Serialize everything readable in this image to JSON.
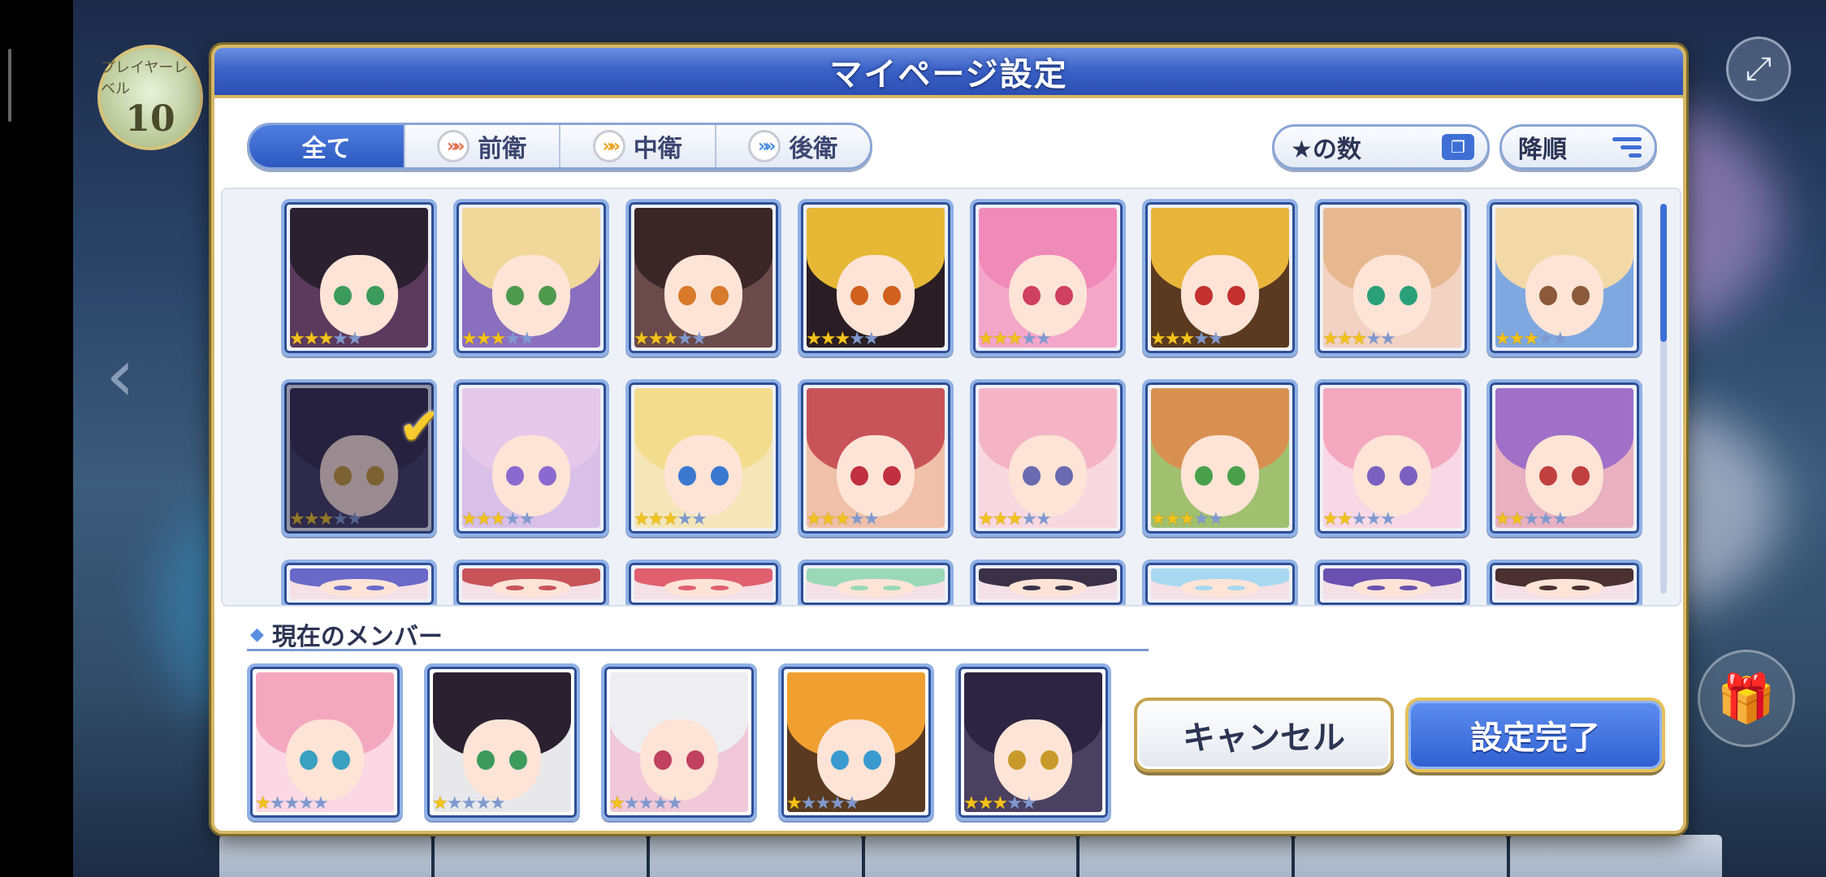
{
  "hud": {
    "level_label": "プレイヤーレベル",
    "level_value": "10"
  },
  "modal": {
    "title": "マイページ設定",
    "filters": [
      {
        "label": "全て",
        "active": true
      },
      {
        "label": "前衛",
        "icon": "red-chevron-icon"
      },
      {
        "label": "中衛",
        "icon": "orange-chevron-icon"
      },
      {
        "label": "後衛",
        "icon": "blue-chevron-icon"
      }
    ],
    "sort_key_label": "★の数",
    "sort_order_label": "降順",
    "characters": [
      {
        "stars": 3,
        "max": 5,
        "hair": "#2a2030",
        "eye": "#3c9a5c",
        "bg": "#5b3a5e"
      },
      {
        "stars": 3,
        "max": 5,
        "hair": "#f1d79a",
        "eye": "#4e9a4e",
        "bg": "#8a6fbf"
      },
      {
        "stars": 3,
        "max": 5,
        "hair": "#3a2626",
        "eye": "#d87a2a",
        "bg": "#6a4a4a"
      },
      {
        "stars": 3,
        "max": 5,
        "hair": "#e7b836",
        "eye": "#d06020",
        "bg": "#2a1e24"
      },
      {
        "stars": 3,
        "max": 5,
        "hair": "#f08ab8",
        "eye": "#d04060",
        "bg": "#f4a6c8"
      },
      {
        "stars": 3,
        "max": 5,
        "hair": "#e9b43a",
        "eye": "#c43030",
        "bg": "#5a3a20"
      },
      {
        "stars": 3,
        "max": 5,
        "hair": "#e7b890",
        "eye": "#2aa07a",
        "bg": "#f2d2c2"
      },
      {
        "stars": 3,
        "max": 5,
        "hair": "#f4d9a8",
        "eye": "#8a5a3a",
        "bg": "#7fa8e0"
      },
      {
        "stars": 3,
        "max": 5,
        "hair": "#2c2440",
        "eye": "#c89a2a",
        "bg": "#3a3458",
        "selected": true
      },
      {
        "stars": 3,
        "max": 5,
        "hair": "#e6c8ea",
        "eye": "#8a6ad0",
        "bg": "#d8c0e8"
      },
      {
        "stars": 3,
        "max": 5,
        "hair": "#f4dc8e",
        "eye": "#3a78d0",
        "bg": "#f4e6b8"
      },
      {
        "stars": 3,
        "max": 5,
        "hair": "#c8545a",
        "eye": "#c03040",
        "bg": "#f0c0a8"
      },
      {
        "stars": 3,
        "max": 5,
        "hair": "#f4b4c6",
        "eye": "#6a6ab0",
        "bg": "#f8d8e0"
      },
      {
        "stars": 3,
        "max": 5,
        "hair": "#d89050",
        "eye": "#4aa04a",
        "bg": "#a0c070"
      },
      {
        "stars": 2,
        "max": 5,
        "hair": "#f4a8c0",
        "eye": "#7a60c0",
        "bg": "#f8d8e4"
      },
      {
        "stars": 2,
        "max": 5,
        "hair": "#a070c8",
        "eye": "#c04040",
        "bg": "#e8b0c0"
      }
    ],
    "peek_colors": [
      "#6a68c8",
      "#c8545a",
      "#e06070",
      "#9ad8b8",
      "#3a3048",
      "#a8d8f0",
      "#6a50b0",
      "#4a3030"
    ],
    "members_title": "現在のメンバー",
    "members": [
      {
        "stars": 1,
        "max": 5,
        "hair": "#f4a8c0",
        "eye": "#3aa0c0",
        "bg": "#fbd8e4"
      },
      {
        "stars": 1,
        "max": 5,
        "hair": "#2a2030",
        "eye": "#3c9a5c",
        "bg": "#e8e8ea"
      },
      {
        "stars": 1,
        "max": 5,
        "hair": "#eeeef2",
        "eye": "#c04060",
        "bg": "#f0c8d8"
      },
      {
        "stars": 1,
        "max": 5,
        "hair": "#f0a030",
        "eye": "#3a9ad0",
        "bg": "#5a3a20"
      },
      {
        "stars": 3,
        "max": 5,
        "hair": "#2c2440",
        "eye": "#c89a2a",
        "bg": "#4a4060"
      }
    ],
    "cancel_label": "キャンセル",
    "confirm_label": "設定完了"
  }
}
